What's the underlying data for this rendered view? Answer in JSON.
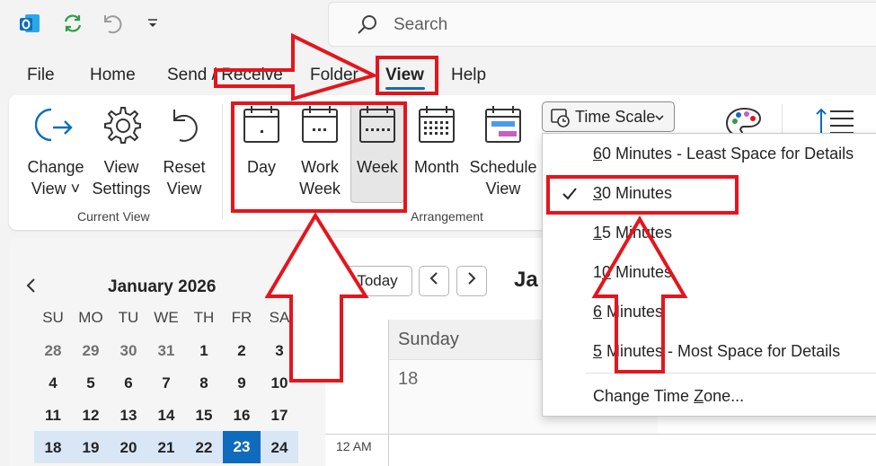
{
  "quick_access": {
    "app_icon": "outlook-icon",
    "sync_icon": "sync-icon",
    "undo_icon": "undo-icon",
    "customize_icon": "customize-dropdown-icon"
  },
  "search": {
    "placeholder": "Search"
  },
  "tabs": [
    {
      "label": "File"
    },
    {
      "label": "Home"
    },
    {
      "label": "Send / Receive"
    },
    {
      "label": "Folder"
    },
    {
      "label": "View"
    },
    {
      "label": "Help"
    }
  ],
  "ribbon": {
    "current_view": {
      "buttons": [
        {
          "line1": "Change",
          "line2": "View ˅",
          "icon": "change-view-icon"
        },
        {
          "line1": "View",
          "line2": "Settings",
          "icon": "gear-icon"
        },
        {
          "line1": "Reset",
          "line2": "View",
          "icon": "undo-icon"
        }
      ],
      "group_label": "Current View"
    },
    "arrangement": {
      "buttons": [
        {
          "line1": "Day",
          "line2": "",
          "icon": "day-calendar-icon"
        },
        {
          "line1": "Work",
          "line2": "Week",
          "icon": "work-week-calendar-icon"
        },
        {
          "line1": "Week",
          "line2": "",
          "icon": "week-calendar-icon"
        },
        {
          "line1": "Month",
          "line2": "",
          "icon": "month-calendar-icon"
        },
        {
          "line1": "Schedule",
          "line2": "View",
          "icon": "schedule-view-icon"
        }
      ],
      "group_label": "Arrangement"
    },
    "time_scale": {
      "label": "Time Scale",
      "icon": "time-scale-icon"
    }
  },
  "time_scale_menu": {
    "items": [
      {
        "pre": "",
        "ul": "6",
        "post": "0 Minutes - Least Space for Details",
        "checked": false
      },
      {
        "pre": "",
        "ul": "3",
        "post": "0 Minutes",
        "checked": true
      },
      {
        "pre": "",
        "ul": "1",
        "post": "5 Minutes",
        "checked": false
      },
      {
        "pre": "1",
        "ul": "0",
        "post": " Minutes",
        "checked": false
      },
      {
        "pre": "",
        "ul": "6",
        "post": " Minutes",
        "checked": false
      },
      {
        "pre": "",
        "ul": "5",
        "post": " Minutes - Most Space for Details",
        "checked": false
      }
    ],
    "change_tz": {
      "pre": "Change Time ",
      "ul": "Z",
      "post": "one..."
    }
  },
  "mini_calendar": {
    "month": "January 2026",
    "weekdays": [
      "SU",
      "MO",
      "TU",
      "WE",
      "TH",
      "FR",
      "SA"
    ],
    "weeks": [
      [
        "28",
        "29",
        "30",
        "31",
        "1",
        "2",
        "3"
      ],
      [
        "4",
        "5",
        "6",
        "7",
        "8",
        "9",
        "10"
      ],
      [
        "11",
        "12",
        "13",
        "14",
        "15",
        "16",
        "17"
      ],
      [
        "18",
        "19",
        "20",
        "21",
        "22",
        "23",
        "24"
      ]
    ],
    "today": "23"
  },
  "calendar": {
    "today_button": "Today",
    "month_partial": "Ja",
    "day_name": "Sunday",
    "day_number": "18",
    "time_label": "12 AM"
  },
  "colors": {
    "accent": "#0f6cbd",
    "annotation_red": "#e4151d",
    "selected_week_row": "#d8e6f6"
  }
}
